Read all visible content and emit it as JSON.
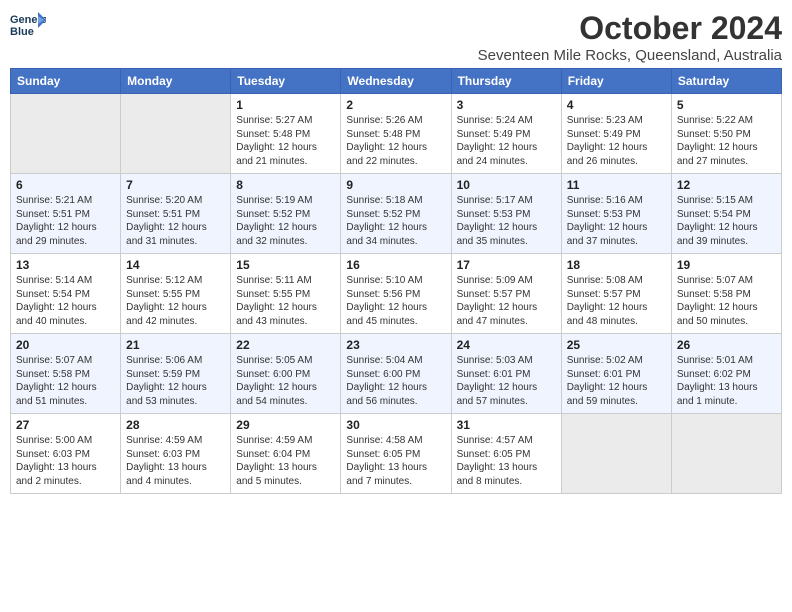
{
  "header": {
    "logo_line1": "General",
    "logo_line2": "Blue",
    "month": "October 2024",
    "location": "Seventeen Mile Rocks, Queensland, Australia"
  },
  "days_of_week": [
    "Sunday",
    "Monday",
    "Tuesday",
    "Wednesday",
    "Thursday",
    "Friday",
    "Saturday"
  ],
  "weeks": [
    [
      {
        "day": "",
        "empty": true
      },
      {
        "day": "",
        "empty": true
      },
      {
        "day": "1",
        "sunrise": "5:27 AM",
        "sunset": "5:48 PM",
        "daylight": "12 hours and 21 minutes."
      },
      {
        "day": "2",
        "sunrise": "5:26 AM",
        "sunset": "5:48 PM",
        "daylight": "12 hours and 22 minutes."
      },
      {
        "day": "3",
        "sunrise": "5:24 AM",
        "sunset": "5:49 PM",
        "daylight": "12 hours and 24 minutes."
      },
      {
        "day": "4",
        "sunrise": "5:23 AM",
        "sunset": "5:49 PM",
        "daylight": "12 hours and 26 minutes."
      },
      {
        "day": "5",
        "sunrise": "5:22 AM",
        "sunset": "5:50 PM",
        "daylight": "12 hours and 27 minutes."
      }
    ],
    [
      {
        "day": "6",
        "sunrise": "5:21 AM",
        "sunset": "5:51 PM",
        "daylight": "12 hours and 29 minutes."
      },
      {
        "day": "7",
        "sunrise": "5:20 AM",
        "sunset": "5:51 PM",
        "daylight": "12 hours and 31 minutes."
      },
      {
        "day": "8",
        "sunrise": "5:19 AM",
        "sunset": "5:52 PM",
        "daylight": "12 hours and 32 minutes."
      },
      {
        "day": "9",
        "sunrise": "5:18 AM",
        "sunset": "5:52 PM",
        "daylight": "12 hours and 34 minutes."
      },
      {
        "day": "10",
        "sunrise": "5:17 AM",
        "sunset": "5:53 PM",
        "daylight": "12 hours and 35 minutes."
      },
      {
        "day": "11",
        "sunrise": "5:16 AM",
        "sunset": "5:53 PM",
        "daylight": "12 hours and 37 minutes."
      },
      {
        "day": "12",
        "sunrise": "5:15 AM",
        "sunset": "5:54 PM",
        "daylight": "12 hours and 39 minutes."
      }
    ],
    [
      {
        "day": "13",
        "sunrise": "5:14 AM",
        "sunset": "5:54 PM",
        "daylight": "12 hours and 40 minutes."
      },
      {
        "day": "14",
        "sunrise": "5:12 AM",
        "sunset": "5:55 PM",
        "daylight": "12 hours and 42 minutes."
      },
      {
        "day": "15",
        "sunrise": "5:11 AM",
        "sunset": "5:55 PM",
        "daylight": "12 hours and 43 minutes."
      },
      {
        "day": "16",
        "sunrise": "5:10 AM",
        "sunset": "5:56 PM",
        "daylight": "12 hours and 45 minutes."
      },
      {
        "day": "17",
        "sunrise": "5:09 AM",
        "sunset": "5:57 PM",
        "daylight": "12 hours and 47 minutes."
      },
      {
        "day": "18",
        "sunrise": "5:08 AM",
        "sunset": "5:57 PM",
        "daylight": "12 hours and 48 minutes."
      },
      {
        "day": "19",
        "sunrise": "5:07 AM",
        "sunset": "5:58 PM",
        "daylight": "12 hours and 50 minutes."
      }
    ],
    [
      {
        "day": "20",
        "sunrise": "5:07 AM",
        "sunset": "5:58 PM",
        "daylight": "12 hours and 51 minutes."
      },
      {
        "day": "21",
        "sunrise": "5:06 AM",
        "sunset": "5:59 PM",
        "daylight": "12 hours and 53 minutes."
      },
      {
        "day": "22",
        "sunrise": "5:05 AM",
        "sunset": "6:00 PM",
        "daylight": "12 hours and 54 minutes."
      },
      {
        "day": "23",
        "sunrise": "5:04 AM",
        "sunset": "6:00 PM",
        "daylight": "12 hours and 56 minutes."
      },
      {
        "day": "24",
        "sunrise": "5:03 AM",
        "sunset": "6:01 PM",
        "daylight": "12 hours and 57 minutes."
      },
      {
        "day": "25",
        "sunrise": "5:02 AM",
        "sunset": "6:01 PM",
        "daylight": "12 hours and 59 minutes."
      },
      {
        "day": "26",
        "sunrise": "5:01 AM",
        "sunset": "6:02 PM",
        "daylight": "13 hours and 1 minute."
      }
    ],
    [
      {
        "day": "27",
        "sunrise": "5:00 AM",
        "sunset": "6:03 PM",
        "daylight": "13 hours and 2 minutes."
      },
      {
        "day": "28",
        "sunrise": "4:59 AM",
        "sunset": "6:03 PM",
        "daylight": "13 hours and 4 minutes."
      },
      {
        "day": "29",
        "sunrise": "4:59 AM",
        "sunset": "6:04 PM",
        "daylight": "13 hours and 5 minutes."
      },
      {
        "day": "30",
        "sunrise": "4:58 AM",
        "sunset": "6:05 PM",
        "daylight": "13 hours and 7 minutes."
      },
      {
        "day": "31",
        "sunrise": "4:57 AM",
        "sunset": "6:05 PM",
        "daylight": "13 hours and 8 minutes."
      },
      {
        "day": "",
        "empty": true
      },
      {
        "day": "",
        "empty": true
      }
    ]
  ]
}
